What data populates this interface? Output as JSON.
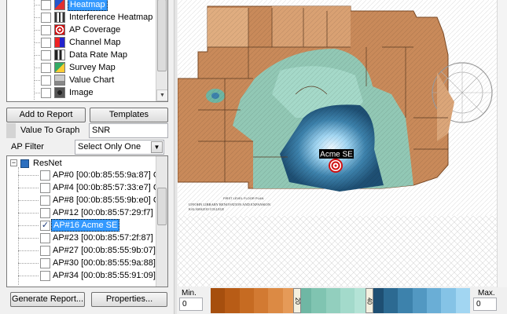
{
  "report_items": [
    {
      "label": "Heatmap",
      "checked": false,
      "selected": true,
      "icon": "heatmap-icon"
    },
    {
      "label": "Interference Heatmap",
      "checked": false,
      "selected": false,
      "icon": "interference-heatmap-icon"
    },
    {
      "label": "AP Coverage",
      "checked": false,
      "selected": false,
      "icon": "ap-coverage-icon"
    },
    {
      "label": "Channel Map",
      "checked": false,
      "selected": false,
      "icon": "channel-map-icon"
    },
    {
      "label": "Data Rate Map",
      "checked": false,
      "selected": false,
      "icon": "data-rate-map-icon"
    },
    {
      "label": "Survey Map",
      "checked": false,
      "selected": false,
      "icon": "survey-map-icon"
    },
    {
      "label": "Value Chart",
      "checked": false,
      "selected": false,
      "icon": "value-chart-icon"
    },
    {
      "label": "Image",
      "checked": false,
      "selected": false,
      "icon": "camera-icon"
    }
  ],
  "buttons": {
    "add_to_report": "Add to Report",
    "templates": "Templates",
    "generate_report": "Generate Report...",
    "properties": "Properties..."
  },
  "value_to_graph": {
    "label": "Value To Graph",
    "value": "SNR"
  },
  "ap_filter": {
    "label": "AP Filter",
    "value": "Select Only One"
  },
  "ap_tree": {
    "root": "ResNet",
    "items": [
      {
        "label": "AP#0 [00:0b:85:55:9a:87] C",
        "checked": false,
        "selected": false
      },
      {
        "label": "AP#4 [00:0b:85:57:33:e7] C",
        "checked": false,
        "selected": false
      },
      {
        "label": "AP#8 [00:0b:85:55:9b:e0] C",
        "checked": false,
        "selected": false
      },
      {
        "label": "AP#12 [00:0b:85:57:29:f7] I",
        "checked": false,
        "selected": false
      },
      {
        "label": "AP#16 Acme SE",
        "checked": true,
        "selected": true
      },
      {
        "label": "AP#23 [00:0b:85:57:2f:87] (",
        "checked": false,
        "selected": false
      },
      {
        "label": "AP#27 [00:0b:85:55:9b:07]",
        "checked": false,
        "selected": false
      },
      {
        "label": "AP#30 [00:0b:85:55:9a:88]",
        "checked": false,
        "selected": false
      },
      {
        "label": "AP#34 [00:0b:85:55:91:09]",
        "checked": false,
        "selected": false
      }
    ]
  },
  "map": {
    "ap_marker_label": "Acme SE",
    "plan_caption_1": "FIRST LEVEL FLOOR PLAN",
    "plan_caption_2": "UPJOHN LIBRARY RENOVATION AND EXPANSION",
    "plan_caption_3": "KALAMAZOO COLLEGE"
  },
  "legend": {
    "min_label": "Min.",
    "min_value": "0",
    "max_label": "Max.",
    "max_value": "0",
    "marker_1": "20",
    "marker_2": "40",
    "colors": [
      "#a64f0e",
      "#b85c16",
      "#c66b22",
      "#d27a32",
      "#dc8a44",
      "#e59a58",
      "#6fb7a4",
      "#80c4b1",
      "#92cfbe",
      "#a3dacb",
      "#b4e3d6",
      "#1e4f73",
      "#2c6a92",
      "#3d82ac",
      "#5298c2",
      "#6aaed6",
      "#85c3e6",
      "#a2d6f2"
    ]
  }
}
